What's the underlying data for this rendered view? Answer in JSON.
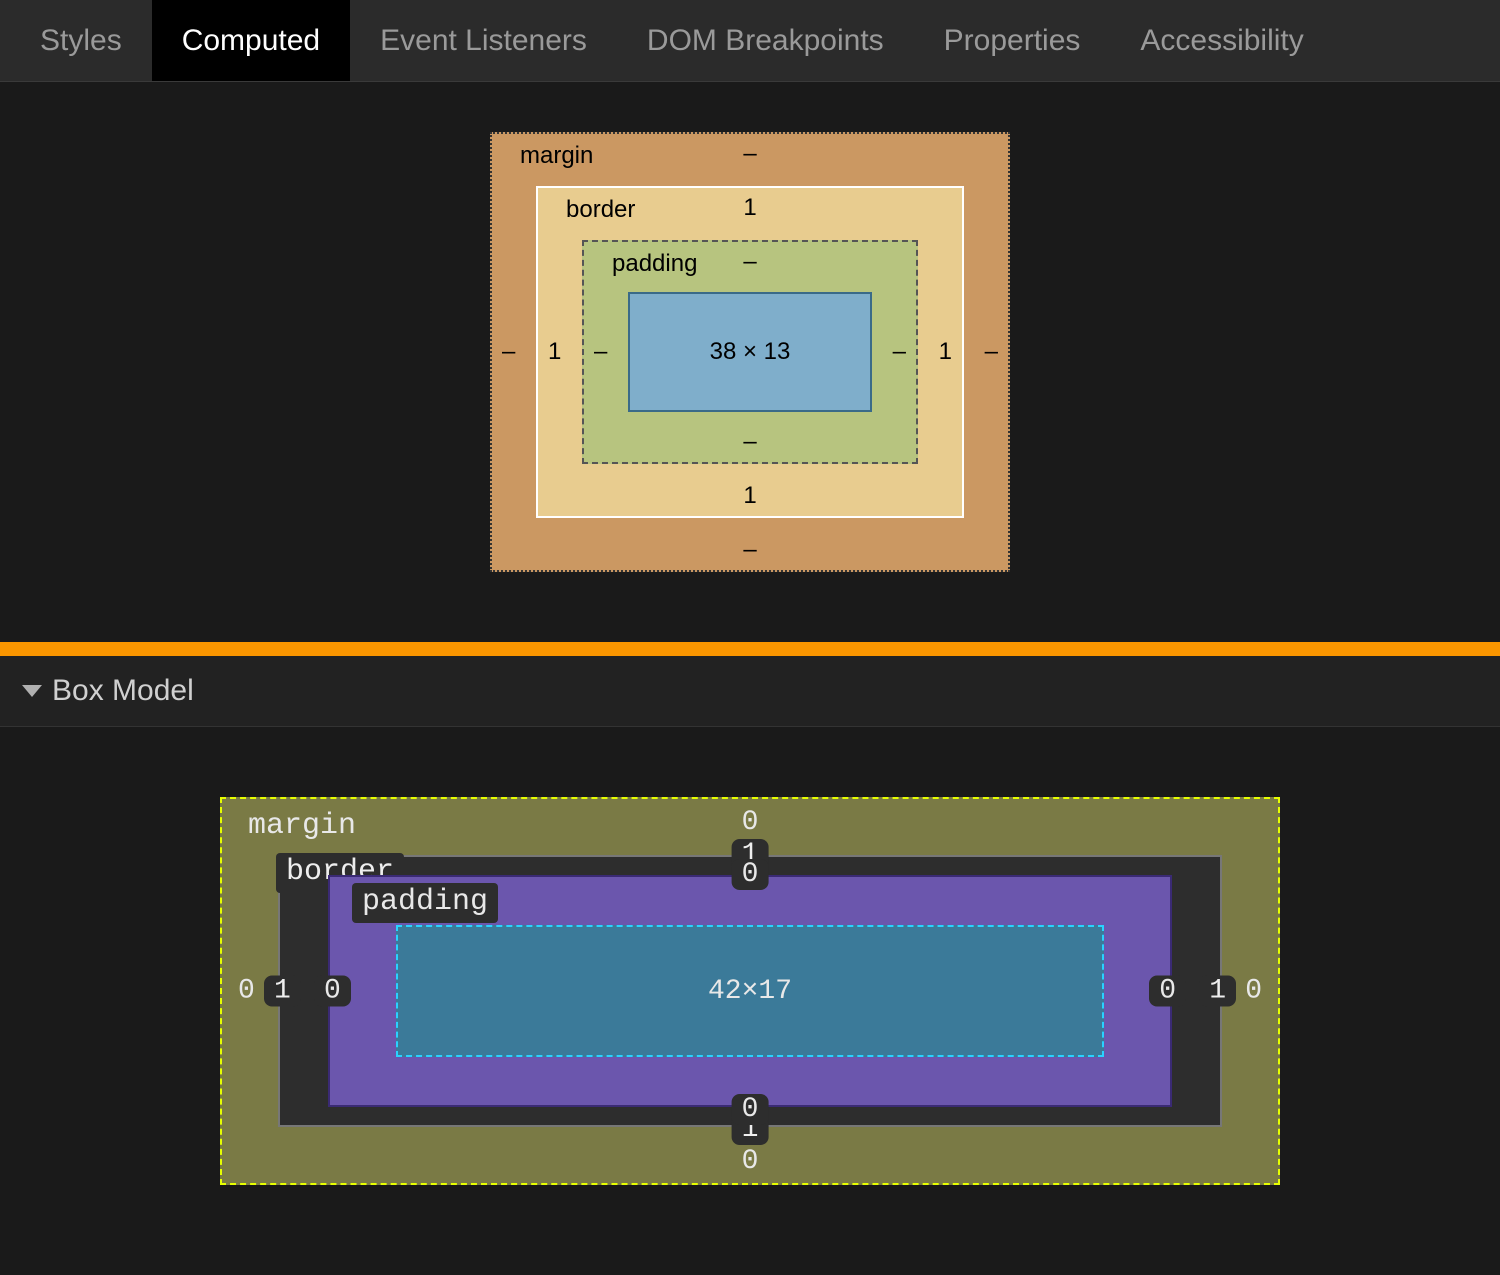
{
  "tabs": {
    "styles": "Styles",
    "computed": "Computed",
    "event_listeners": "Event Listeners",
    "dom_breakpoints": "DOM Breakpoints",
    "properties": "Properties",
    "accessibility": "Accessibility"
  },
  "chrome_box": {
    "margin": {
      "label": "margin",
      "top": "–",
      "right": "–",
      "bottom": "–",
      "left": "–"
    },
    "border": {
      "label": "border",
      "top": "1",
      "right": "1",
      "bottom": "1",
      "left": "1"
    },
    "padding": {
      "label": "padding",
      "top": "–",
      "right": "–",
      "bottom": "–",
      "left": "–"
    },
    "content": "38 × 13"
  },
  "section": {
    "title": "Box Model"
  },
  "ff_box": {
    "margin": {
      "label": "margin",
      "top": "0",
      "right": "0",
      "bottom": "0",
      "left": "0"
    },
    "border": {
      "label": "border",
      "top": "1",
      "right": "1",
      "bottom": "1",
      "left": "1"
    },
    "padding": {
      "label": "padding",
      "top": "0",
      "right": "0",
      "bottom": "0",
      "left": "0"
    },
    "content": "42×17"
  }
}
